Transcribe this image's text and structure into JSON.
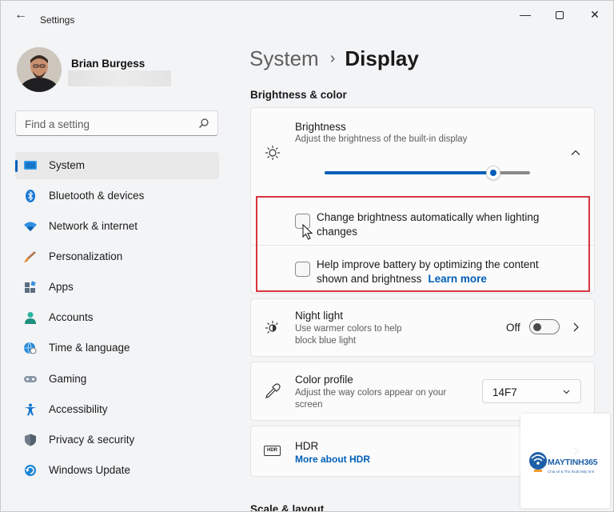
{
  "window": {
    "title": "Settings",
    "back": "←",
    "minimize": "—",
    "close": "✕"
  },
  "profile": {
    "name": "Brian Burgess"
  },
  "search": {
    "placeholder": "Find a setting"
  },
  "sidebar": {
    "items": [
      {
        "label": "System",
        "icon": "system-icon",
        "active": true
      },
      {
        "label": "Bluetooth & devices",
        "icon": "bluetooth-icon"
      },
      {
        "label": "Network & internet",
        "icon": "wifi-icon"
      },
      {
        "label": "Personalization",
        "icon": "brush-icon"
      },
      {
        "label": "Apps",
        "icon": "apps-icon"
      },
      {
        "label": "Accounts",
        "icon": "accounts-icon"
      },
      {
        "label": "Time & language",
        "icon": "globe-clock-icon"
      },
      {
        "label": "Gaming",
        "icon": "gamepad-icon"
      },
      {
        "label": "Accessibility",
        "icon": "accessibility-icon"
      },
      {
        "label": "Privacy & security",
        "icon": "shield-icon"
      },
      {
        "label": "Windows Update",
        "icon": "update-icon"
      }
    ]
  },
  "breadcrumb": {
    "parent": "System",
    "separator": "›",
    "current": "Display"
  },
  "section": {
    "title": "Brightness & color"
  },
  "brightness": {
    "title": "Brightness",
    "description": "Adjust the brightness of the built-in display",
    "level_fraction": 0.82,
    "auto_label": "Change brightness automatically when lighting changes",
    "auto_checked": false,
    "battery_label": "Help improve battery by optimizing the content shown and brightness",
    "battery_checked": false,
    "learn_more": "Learn more"
  },
  "night_light": {
    "title": "Night light",
    "description": "Use warmer colors to help block blue light",
    "state_label": "Off",
    "enabled": false
  },
  "color_profile": {
    "title": "Color profile",
    "description": "Adjust the way colors appear on your screen",
    "value": "14F7"
  },
  "hdr": {
    "title": "HDR",
    "badge": "HDR",
    "link": "More about HDR"
  },
  "next_section": {
    "title": "Scale & layout"
  },
  "watermark": {
    "brand": "MAYTINH365",
    "tagline": "Chia sẻ & Thủ thuật Máy tính"
  },
  "colors": {
    "accent": "#005fb8",
    "highlight": "#d9363e"
  }
}
